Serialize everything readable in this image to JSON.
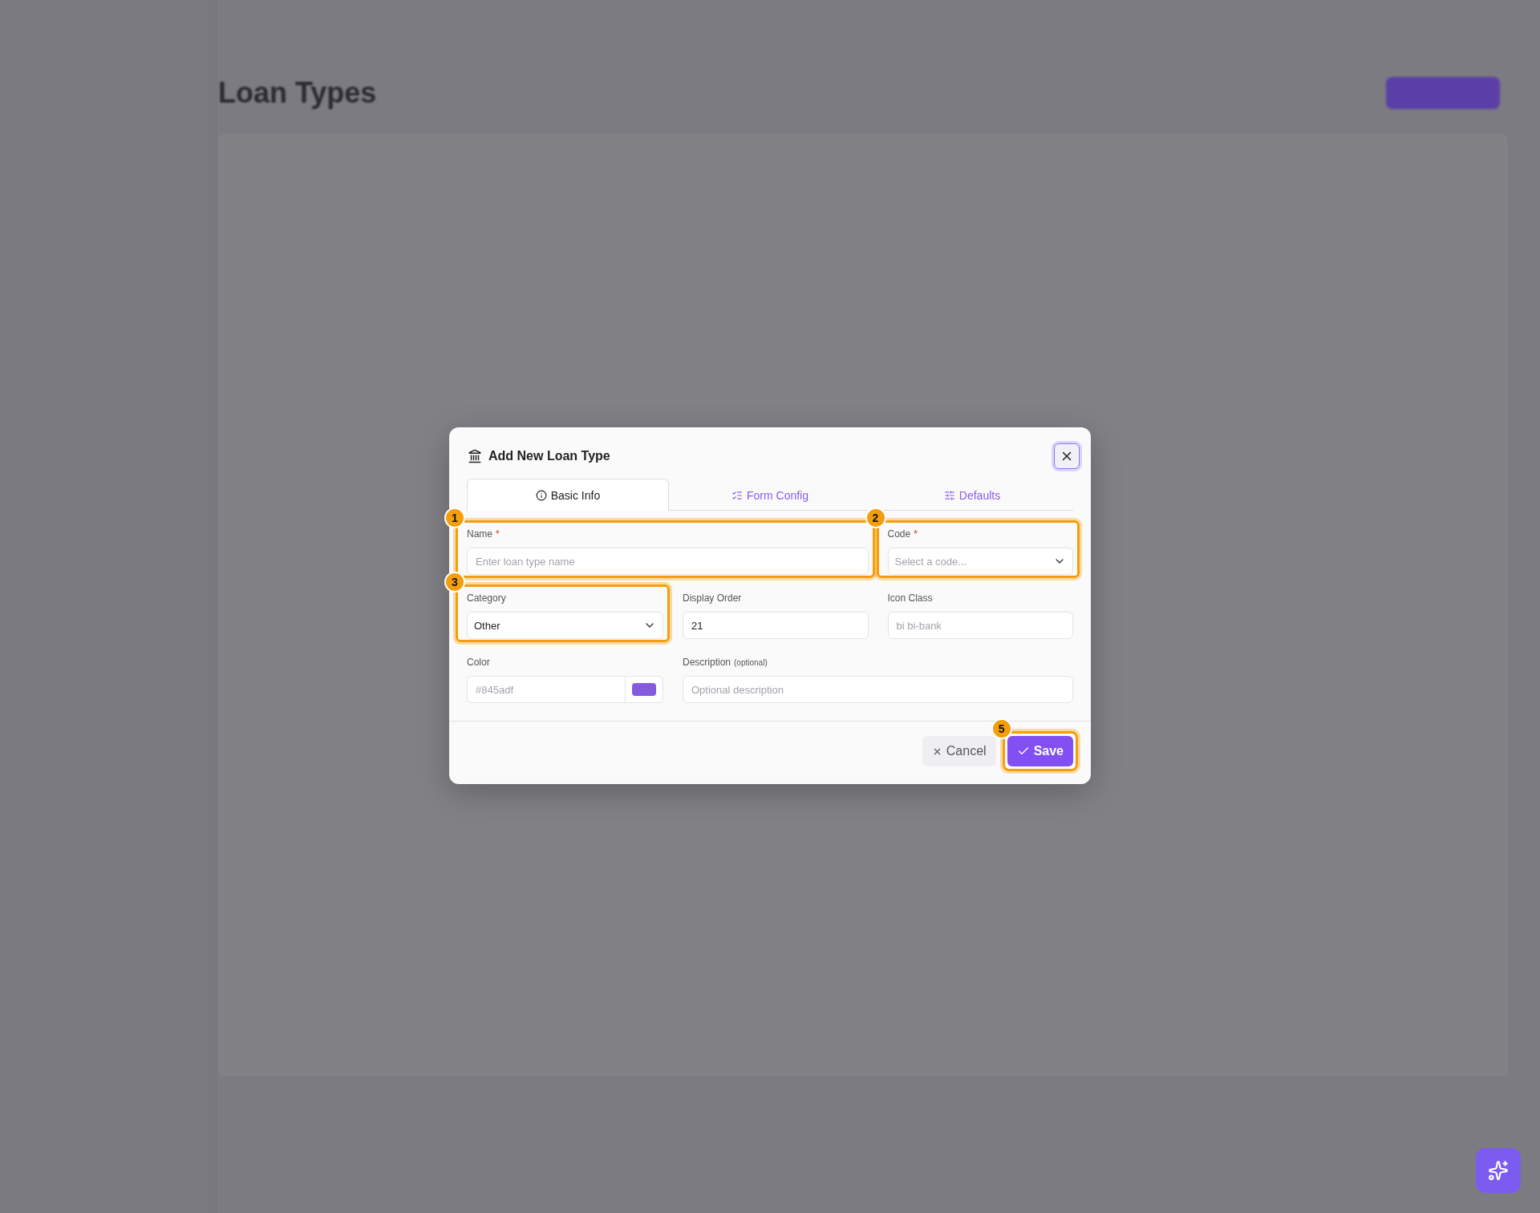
{
  "page": {
    "title": "Loan Types"
  },
  "dialog": {
    "title": "Add New Loan Type",
    "tabs": [
      {
        "label": "Basic Info",
        "selected": true
      },
      {
        "label": "Form Config",
        "selected": false
      },
      {
        "label": "Defaults",
        "selected": false
      }
    ],
    "fields": [
      {
        "kind": "wide",
        "label": "Name",
        "required_mark": "*",
        "placeholder": "Enter loan type name",
        "callout": "1"
      },
      {
        "kind": "select",
        "label": "Code",
        "required_mark": "*",
        "placeholder": "Select a code...",
        "callout": "2"
      },
      {
        "kind": "select",
        "label": "Category",
        "value": "Other",
        "callout": "3"
      },
      {
        "kind": "text",
        "label": "Display Order",
        "value": "21"
      },
      {
        "kind": "text",
        "label": "Icon Class",
        "placeholder": "bi bi-bank"
      },
      {
        "kind": "color",
        "label": "Color",
        "placeholder": "#845adf",
        "color": "#845adf"
      },
      {
        "kind": "wide",
        "label": "Description",
        "hint": "(optional)",
        "placeholder": "Optional description"
      }
    ],
    "buttons": [
      {
        "kind": "cancel",
        "label": "Cancel"
      },
      {
        "kind": "save",
        "label": "Save",
        "callout": "5"
      }
    ]
  }
}
